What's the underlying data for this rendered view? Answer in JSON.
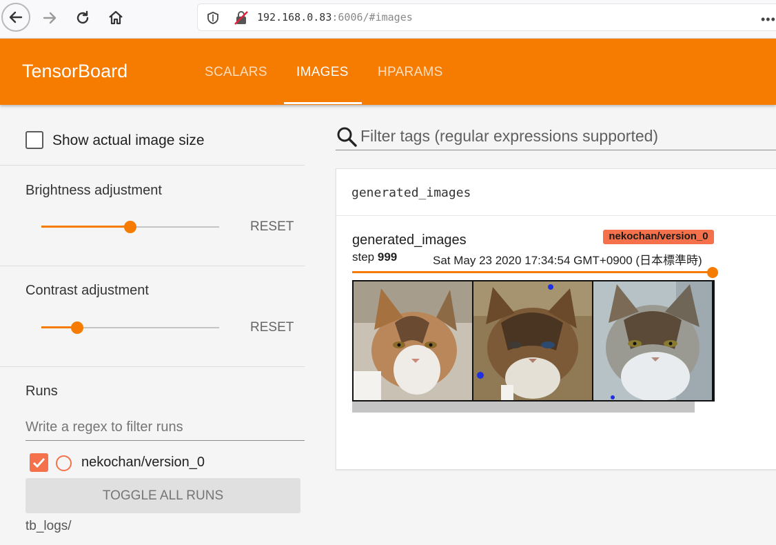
{
  "browser": {
    "url_host": "192.168.0.83",
    "url_rest": ":6006/#images",
    "icons": [
      "back-icon",
      "forward-icon",
      "reload-icon",
      "home-icon",
      "shield-icon",
      "insecure-lock-icon",
      "more-icon"
    ]
  },
  "header": {
    "brand": "TensorBoard",
    "tabs": [
      {
        "label": "SCALARS",
        "active": false
      },
      {
        "label": "IMAGES",
        "active": true
      },
      {
        "label": "HPARAMS",
        "active": false
      }
    ],
    "accent_color": "#f57c00"
  },
  "sidebar": {
    "show_actual_size_label": "Show actual image size",
    "show_actual_size_checked": false,
    "brightness": {
      "title": "Brightness adjustment",
      "value_fraction": 0.5,
      "reset_label": "RESET"
    },
    "contrast": {
      "title": "Contrast adjustment",
      "value_fraction": 0.2,
      "reset_label": "RESET"
    },
    "runs": {
      "title": "Runs",
      "filter_placeholder": "Write a regex to filter runs",
      "items": [
        {
          "label": "nekochan/version_0",
          "checked": true,
          "color": "#f4714b"
        }
      ],
      "toggle_all_label": "TOGGLE ALL RUNS",
      "logdir": "tb_logs/"
    }
  },
  "main": {
    "filter_placeholder": "Filter tags (regular expressions supported)",
    "card": {
      "title": "generated_images",
      "image_name": "generated_images",
      "run_badge": "nekochan/version_0",
      "step_label": "step",
      "step_value": "999",
      "timestamp": "Sat May 23 2020 17:34:54 GMT+0900 (日本標準時)",
      "step_fraction": 1.0,
      "image_count": 3
    }
  }
}
